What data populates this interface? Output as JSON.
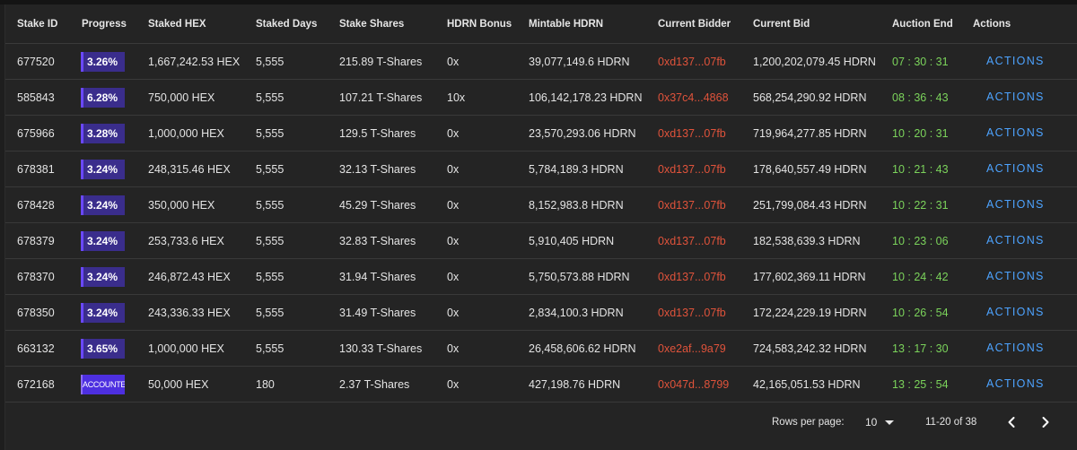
{
  "table": {
    "columns": [
      "Stake ID",
      "Progress",
      "Staked HEX",
      "Staked Days",
      "Stake Shares",
      "HDRN Bonus",
      "Mintable HDRN",
      "Current Bidder",
      "Current Bid",
      "Auction End",
      "Actions"
    ],
    "rows": [
      {
        "stake_id": "677520",
        "progress": "3.26%",
        "staked_hex": "1,667,242.53 HEX",
        "staked_days": "5,555",
        "stake_shares": "215.89 T-Shares",
        "hdrn_bonus": "0x",
        "mintable_hdrn": "39,077,149.6 HDRN",
        "current_bidder": "0xd137...07fb",
        "current_bid": "1,200,202,079.45 HDRN",
        "auction_end": "07 : 30 : 31",
        "action": "ACTIONS"
      },
      {
        "stake_id": "585843",
        "progress": "6.28%",
        "staked_hex": "750,000 HEX",
        "staked_days": "5,555",
        "stake_shares": "107.21 T-Shares",
        "hdrn_bonus": "10x",
        "mintable_hdrn": "106,142,178.23 HDRN",
        "current_bidder": "0x37c4...4868",
        "current_bid": "568,254,290.92 HDRN",
        "auction_end": "08 : 36 : 43",
        "action": "ACTIONS"
      },
      {
        "stake_id": "675966",
        "progress": "3.28%",
        "staked_hex": "1,000,000 HEX",
        "staked_days": "5,555",
        "stake_shares": "129.5 T-Shares",
        "hdrn_bonus": "0x",
        "mintable_hdrn": "23,570,293.06 HDRN",
        "current_bidder": "0xd137...07fb",
        "current_bid": "719,964,277.85 HDRN",
        "auction_end": "10 : 20 : 31",
        "action": "ACTIONS"
      },
      {
        "stake_id": "678381",
        "progress": "3.24%",
        "staked_hex": "248,315.46 HEX",
        "staked_days": "5,555",
        "stake_shares": "32.13 T-Shares",
        "hdrn_bonus": "0x",
        "mintable_hdrn": "5,784,189.3 HDRN",
        "current_bidder": "0xd137...07fb",
        "current_bid": "178,640,557.49 HDRN",
        "auction_end": "10 : 21 : 43",
        "action": "ACTIONS"
      },
      {
        "stake_id": "678428",
        "progress": "3.24%",
        "staked_hex": "350,000 HEX",
        "staked_days": "5,555",
        "stake_shares": "45.29 T-Shares",
        "hdrn_bonus": "0x",
        "mintable_hdrn": "8,152,983.8 HDRN",
        "current_bidder": "0xd137...07fb",
        "current_bid": "251,799,084.43 HDRN",
        "auction_end": "10 : 22 : 31",
        "action": "ACTIONS"
      },
      {
        "stake_id": "678379",
        "progress": "3.24%",
        "staked_hex": "253,733.6 HEX",
        "staked_days": "5,555",
        "stake_shares": "32.83 T-Shares",
        "hdrn_bonus": "0x",
        "mintable_hdrn": "5,910,405 HDRN",
        "current_bidder": "0xd137...07fb",
        "current_bid": "182,538,639.3 HDRN",
        "auction_end": "10 : 23 : 06",
        "action": "ACTIONS"
      },
      {
        "stake_id": "678370",
        "progress": "3.24%",
        "staked_hex": "246,872.43 HEX",
        "staked_days": "5,555",
        "stake_shares": "31.94 T-Shares",
        "hdrn_bonus": "0x",
        "mintable_hdrn": "5,750,573.88 HDRN",
        "current_bidder": "0xd137...07fb",
        "current_bid": "177,602,369.11 HDRN",
        "auction_end": "10 : 24 : 42",
        "action": "ACTIONS"
      },
      {
        "stake_id": "678350",
        "progress": "3.24%",
        "staked_hex": "243,336.33 HEX",
        "staked_days": "5,555",
        "stake_shares": "31.49 T-Shares",
        "hdrn_bonus": "0x",
        "mintable_hdrn": "2,834,100.3 HDRN",
        "current_bidder": "0xd137...07fb",
        "current_bid": "172,224,229.19 HDRN",
        "auction_end": "10 : 26 : 54",
        "action": "ACTIONS"
      },
      {
        "stake_id": "663132",
        "progress": "3.65%",
        "staked_hex": "1,000,000 HEX",
        "staked_days": "5,555",
        "stake_shares": "130.33 T-Shares",
        "hdrn_bonus": "0x",
        "mintable_hdrn": "26,458,606.62 HDRN",
        "current_bidder": "0xe2af...9a79",
        "current_bid": "724,583,242.32 HDRN",
        "auction_end": "13 : 17 : 30",
        "action": "ACTIONS"
      },
      {
        "stake_id": "672168",
        "progress": "ACCOUNTED",
        "staked_hex": "50,000 HEX",
        "staked_days": "180",
        "stake_shares": "2.37 T-Shares",
        "hdrn_bonus": "0x",
        "mintable_hdrn": "427,198.76 HDRN",
        "current_bidder": "0x047d...8799",
        "current_bid": "42,165,051.53 HDRN",
        "auction_end": "13 : 25 : 54",
        "action": "ACTIONS"
      }
    ]
  },
  "pagination": {
    "rows_per_page_label": "Rows per page:",
    "rows_per_page_value": "10",
    "range_text": "11-20 of 38",
    "prev_icon": "chevron-left-icon",
    "next_icon": "chevron-right-icon"
  },
  "colors": {
    "bidder": "#e0533b",
    "auction_end": "#7bd35b",
    "action": "#4da3ff",
    "progress_bg": "#3a2d8c"
  }
}
